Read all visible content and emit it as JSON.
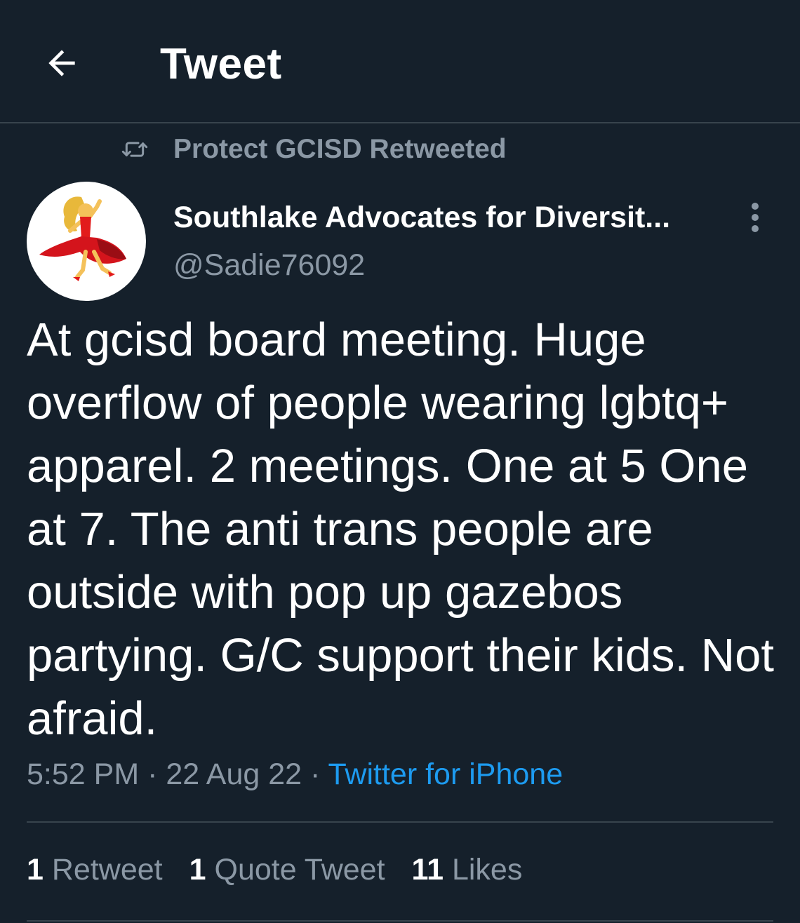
{
  "header": {
    "title": "Tweet",
    "back_icon": "arrow-left-icon"
  },
  "social_context": {
    "icon": "retweet-icon",
    "text": "Protect GCISD Retweeted"
  },
  "author": {
    "display_name": "Southlake Advocates for Diversit...",
    "handle": "@Sadie76092",
    "avatar_icon": "dancer-emoji-avatar"
  },
  "tweet": {
    "text": "At gcisd board meeting. Huge overflow of people wearing lgbtq+ apparel. 2 meetings. One at 5 One at 7. The anti trans people are outside with pop up gazebos partying. G/C support their kids. Not afraid.",
    "time": "5:52 PM",
    "date": "22 Aug 22",
    "separator": "·",
    "source": "Twitter for iPhone"
  },
  "stats": {
    "retweets_count": "1",
    "retweets_label": "Retweet",
    "quotes_count": "1",
    "quotes_label": "Quote Tweet",
    "likes_count": "11",
    "likes_label": "Likes"
  },
  "colors": {
    "background": "#15202b",
    "secondary_text": "#8b98a5",
    "link": "#1d9bf0",
    "divider": "#38444d"
  }
}
